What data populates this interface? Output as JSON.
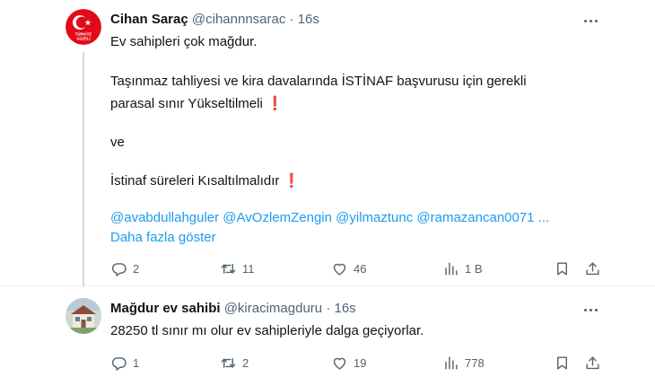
{
  "tweets": [
    {
      "author": {
        "name": "Cihan Saraç",
        "handle": "@cihannnsarac",
        "time": "16s",
        "avatar_label": "TÜRKİYE GÜZELİ"
      },
      "lines": [
        "Ev sahipleri çok mağdur.",
        "Taşınmaz tahliyesi ve kira davalarında İSTİNAF başvurusu için gerekli",
        "parasal sınır Yükseltilmeli",
        "ve",
        "İstinaf süreleri Kısaltılmalıdır"
      ],
      "emphasis": "❗",
      "mentions": "@avabdullahguler @AvOzlemZengin @yilmaztunc @ramazancan0071 ...",
      "show_more": "Daha fazla göster",
      "stats": {
        "replies": "2",
        "reposts": "11",
        "likes": "46",
        "views": "1 B"
      }
    },
    {
      "author": {
        "name": "Mağdur ev sahibi",
        "handle": "@kiracimagduru",
        "time": "16s"
      },
      "lines": [
        "28250 tl sınır mı olur ev sahipleriyle dalga geçiyorlar."
      ],
      "stats": {
        "replies": "1",
        "reposts": "2",
        "likes": "19",
        "views": "778"
      }
    }
  ],
  "separator": "·",
  "icons": [
    "more-icon",
    "reply-icon",
    "repost-icon",
    "like-icon",
    "views-icon",
    "bookmark-icon",
    "share-icon"
  ],
  "colors": {
    "link": "#1d9bf0",
    "text": "#0f1419",
    "muted": "#536471",
    "alert": "#d3202c",
    "avatar_red": "#e30a17"
  }
}
